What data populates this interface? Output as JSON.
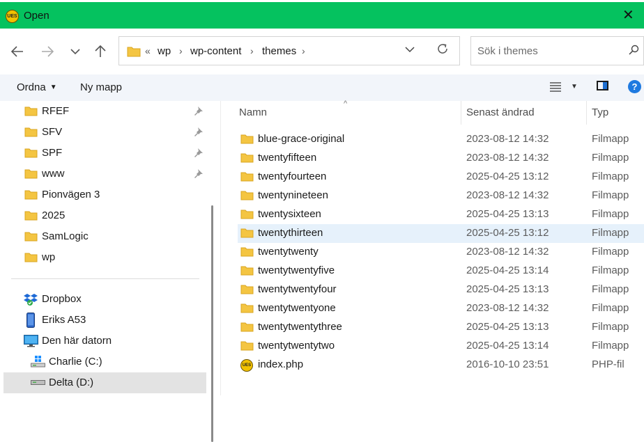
{
  "window": {
    "title": "Open",
    "app_logo_text": "UES"
  },
  "address": {
    "overflow": "«",
    "breadcrumbs": [
      "wp",
      "wp-content",
      "themes"
    ]
  },
  "search": {
    "placeholder": "Sök i themes"
  },
  "commands": {
    "organize": "Ordna",
    "new_folder": "Ny mapp"
  },
  "sidebar": {
    "quick_access": [
      {
        "label": "RFEF",
        "pinned": true
      },
      {
        "label": "SFV",
        "pinned": true
      },
      {
        "label": "SPF",
        "pinned": true
      },
      {
        "label": "www",
        "pinned": true
      },
      {
        "label": "Pionvägen 3",
        "pinned": false
      },
      {
        "label": "2025",
        "pinned": false
      },
      {
        "label": "SamLogic",
        "pinned": false
      },
      {
        "label": "wp",
        "pinned": false
      }
    ],
    "locations": [
      {
        "label": "Dropbox",
        "icon": "dropbox-icon"
      },
      {
        "label": "Eriks A53",
        "icon": "phone-icon"
      },
      {
        "label": "Den här datorn",
        "icon": "computer-icon"
      },
      {
        "label": "Charlie (C:)",
        "icon": "windows-drive-icon"
      },
      {
        "label": "Delta (D:)",
        "icon": "drive-icon",
        "selected": true
      }
    ]
  },
  "columns": {
    "name": "Namn",
    "modified": "Senast ändrad",
    "type": "Typ"
  },
  "files": [
    {
      "name": "blue-grace-original",
      "modified": "2023-08-12 14:32",
      "type": "Filmapp"
    },
    {
      "name": "twentyfifteen",
      "modified": "2023-08-12 14:32",
      "type": "Filmapp"
    },
    {
      "name": "twentyfourteen",
      "modified": "2025-04-25 13:12",
      "type": "Filmapp"
    },
    {
      "name": "twentynineteen",
      "modified": "2023-08-12 14:32",
      "type": "Filmapp"
    },
    {
      "name": "twentysixteen",
      "modified": "2025-04-25 13:13",
      "type": "Filmapp"
    },
    {
      "name": "twentythirteen",
      "modified": "2025-04-25 13:12",
      "type": "Filmapp",
      "selected": true
    },
    {
      "name": "twentytwenty",
      "modified": "2023-08-12 14:32",
      "type": "Filmapp"
    },
    {
      "name": "twentytwentyfive",
      "modified": "2025-04-25 13:14",
      "type": "Filmapp"
    },
    {
      "name": "twentytwentyfour",
      "modified": "2025-04-25 13:13",
      "type": "Filmapp"
    },
    {
      "name": "twentytwentyone",
      "modified": "2023-08-12 14:32",
      "type": "Filmapp"
    },
    {
      "name": "twentytwentythree",
      "modified": "2025-04-25 13:13",
      "type": "Filmapp"
    },
    {
      "name": "twentytwentytwo",
      "modified": "2025-04-25 13:14",
      "type": "Filmapp"
    },
    {
      "name": "index.php",
      "modified": "2016-10-10 23:51",
      "type": "PHP-fil",
      "icon": "php-file-icon"
    }
  ],
  "colors": {
    "titlebar": "#05c25f",
    "selection": "#e6f1fb",
    "folder": "#f4c542"
  }
}
